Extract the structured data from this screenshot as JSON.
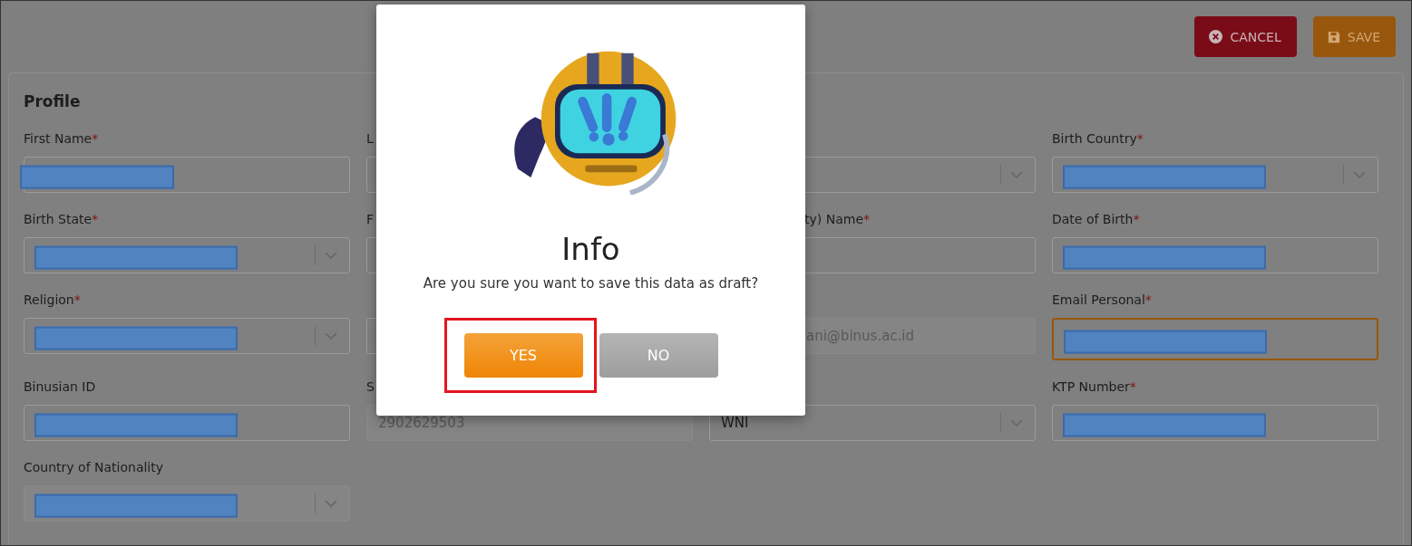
{
  "toolbar": {
    "buttons": [
      {
        "label": "CANCEL",
        "kind": "cancel"
      },
      {
        "label": "SAVE",
        "kind": "save"
      }
    ]
  },
  "profile": {
    "title": "Profile",
    "fields": [
      {
        "label": "First Name",
        "required_mark": "*",
        "kind": "text",
        "redacted": true
      },
      {
        "label": "L",
        "kind": "text"
      },
      {
        "kind": "select"
      },
      {
        "label": "Birth Country",
        "required_mark": "*",
        "kind": "select",
        "redacted": true
      },
      {
        "label": "Birth State",
        "required_mark": "*",
        "kind": "select",
        "redacted": true
      },
      {
        "label": "F",
        "kind": "text"
      },
      {
        "label": "ty) Name",
        "required_mark": "*",
        "kind": "text"
      },
      {
        "label": "Date of Birth",
        "required_mark": "*",
        "kind": "text",
        "redacted": true
      },
      {
        "label": "Religion",
        "required_mark": "*",
        "kind": "select",
        "redacted": true
      },
      {
        "kind": "text"
      },
      {
        "kind": "text",
        "value": "ani@binus.ac.id",
        "disabled": true
      },
      {
        "label": "Email Personal",
        "required_mark": "*",
        "kind": "text",
        "redacted": true,
        "focused": true
      },
      {
        "label": "Binusian ID",
        "kind": "text",
        "redacted": true
      },
      {
        "label": "S",
        "kind": "text",
        "value": "2902629503",
        "disabled": true
      },
      {
        "kind": "select",
        "value": "WNI"
      },
      {
        "label": "KTP Number",
        "required_mark": "*",
        "kind": "text",
        "redacted": true
      },
      {
        "label": "Country of Nationality",
        "kind": "select",
        "redacted": true,
        "disabled": true
      }
    ]
  },
  "dialog": {
    "title": "Info",
    "message": "Are you sure you want to save this data as draft?",
    "buttons": [
      {
        "label": "YES",
        "kind": "confirm",
        "highlighted": true
      },
      {
        "label": "NO",
        "kind": "dismiss",
        "highlighted": false
      }
    ]
  }
}
